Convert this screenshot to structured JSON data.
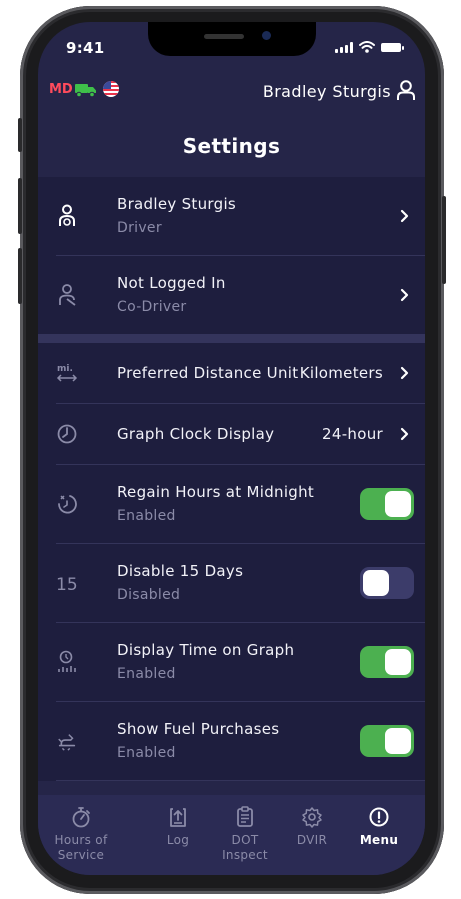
{
  "status_bar": {
    "time": "9:41"
  },
  "topbar": {
    "region": "MD",
    "user_name": "Bradley Sturgis"
  },
  "page": {
    "title": "Settings"
  },
  "drivers": [
    {
      "name": "Bradley Sturgis",
      "role": "Driver",
      "icon": "driver-icon"
    },
    {
      "name": "Not Logged In",
      "role": "Co-Driver",
      "icon": "codriver-icon"
    }
  ],
  "settings": [
    {
      "label": "Preferred Distance Unit",
      "value": "Kilometers",
      "icon": "distance-unit-icon"
    },
    {
      "label": "Graph Clock Display",
      "value": "24-hour",
      "icon": "clock-icon"
    },
    {
      "label": "Regain Hours at Midnight",
      "status": "Enabled",
      "enabled": true,
      "icon": "midnight-icon"
    },
    {
      "label": "Disable 15 Days",
      "status": "Disabled",
      "enabled": false,
      "icon": "fifteen-days-icon"
    },
    {
      "label": "Display Time on Graph",
      "status": "Enabled",
      "enabled": true,
      "icon": "graph-time-icon"
    },
    {
      "label": "Show Fuel Purchases",
      "status": "Enabled",
      "enabled": true,
      "icon": "fuel-icon"
    }
  ],
  "tabs": [
    {
      "label": "Hours of Service",
      "icon": "stopwatch-icon",
      "active": false
    },
    {
      "label": "Log",
      "icon": "log-icon",
      "active": false
    },
    {
      "label": "DOT Inspect",
      "icon": "clipboard-icon",
      "active": false
    },
    {
      "label": "DVIR",
      "icon": "gear-icon",
      "active": false
    },
    {
      "label": "Menu",
      "icon": "info-icon",
      "active": true
    }
  ],
  "colors": {
    "background": "#252548",
    "list_background": "#1e1e3e",
    "toggle_on": "#4cb050",
    "toggle_off": "#3c3c6a",
    "region_red": "#ff4b5c",
    "truck_green": "#3fbf4a",
    "muted_text": "#8b8ba8"
  }
}
